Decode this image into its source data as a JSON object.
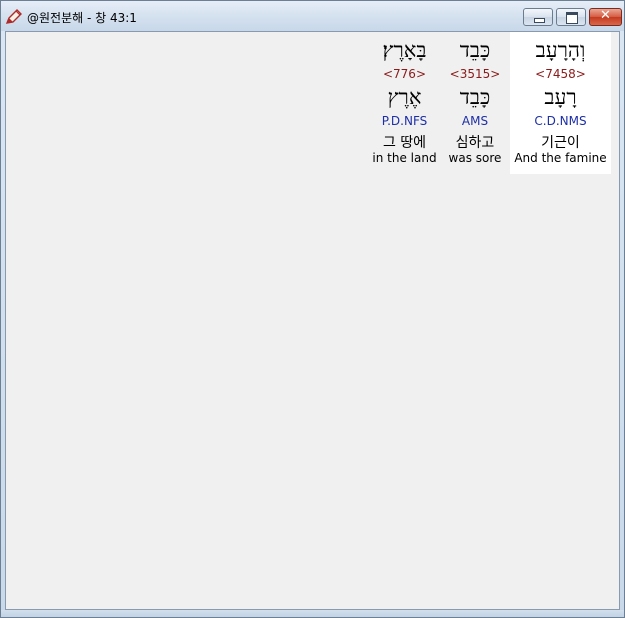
{
  "window": {
    "title": "@원전분해 - 창 43:1",
    "icon": "app-pencil-icon",
    "controls": {
      "minimize": "minimize-icon",
      "maximize": "maximize-icon",
      "close": "close-icon",
      "close_glyph": "✕"
    },
    "colors": {
      "selected_column": "#ffffff",
      "strong_number": "#8b1a1a",
      "morphology": "#1d2fa8",
      "client_bg": "#f0f0f0"
    }
  },
  "words": [
    {
      "hebrew": "וְהָרָעָב",
      "strong": "<7458>",
      "lemma": "רָעָב",
      "morph": "C.D.NMS",
      "korean": "기근이",
      "english": "And the famine",
      "selected": true
    },
    {
      "hebrew": "כָּבֵד",
      "strong": "<3515>",
      "lemma": "כָּבֵד",
      "morph": "AMS",
      "korean": "심하고",
      "english": "was sore",
      "selected": false
    },
    {
      "hebrew": "בָּאָרֶץ׃",
      "strong": "<776>",
      "lemma": "אֶרֶץ",
      "morph": "P.D.NFS",
      "korean": "그 땅에",
      "english": "in the land",
      "selected": false
    }
  ]
}
